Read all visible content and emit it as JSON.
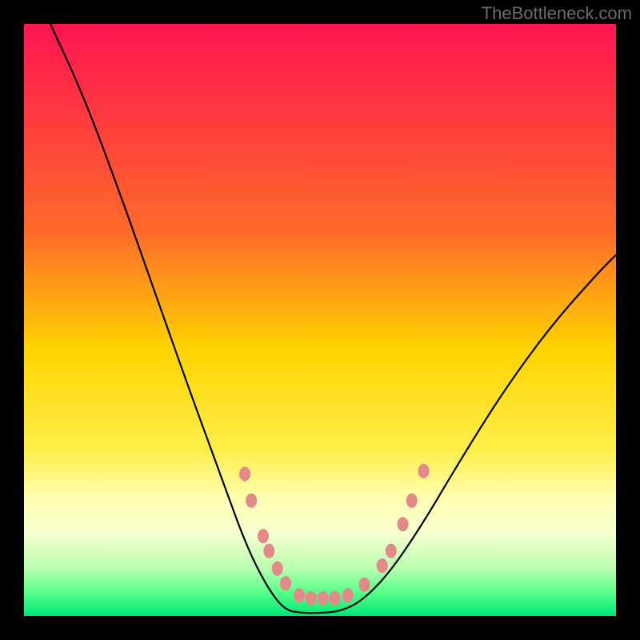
{
  "watermark": "TheBottleneck.com",
  "chart_data": {
    "type": "line",
    "title": "",
    "xlabel": "",
    "ylabel": "",
    "xlim": [
      0,
      100
    ],
    "ylim": [
      0,
      100
    ],
    "gradient_stops": [
      {
        "offset": 0,
        "color": "#ff1451"
      },
      {
        "offset": 35,
        "color": "#ff6a2a"
      },
      {
        "offset": 55,
        "color": "#ffd400"
      },
      {
        "offset": 72,
        "color": "#ffee4a"
      },
      {
        "offset": 80,
        "color": "#ffffb0"
      },
      {
        "offset": 86,
        "color": "#f7ffd0"
      },
      {
        "offset": 92,
        "color": "#b8ffb0"
      },
      {
        "offset": 96,
        "color": "#58ff8a"
      },
      {
        "offset": 100,
        "color": "#00e874"
      }
    ],
    "series": [
      {
        "name": "bottleneck-curve",
        "x": [
          4,
          10,
          16,
          22,
          28,
          33.5,
          37.5,
          41,
          44,
          47,
          50,
          53.5,
          57,
          61.5,
          67,
          73.5,
          81,
          89,
          97,
          100
        ],
        "values": [
          101,
          88,
          72,
          55,
          38,
          23,
          12,
          5,
          1,
          0.5,
          0.5,
          0.8,
          2.5,
          7,
          15,
          26,
          38,
          49,
          58,
          61
        ]
      }
    ],
    "markers": {
      "name": "highlight-dots",
      "color": "#e38a89",
      "rx": 7,
      "ry": 9,
      "points": [
        {
          "x": 37.3,
          "y": 24.0
        },
        {
          "x": 38.4,
          "y": 19.5
        },
        {
          "x": 40.4,
          "y": 13.5
        },
        {
          "x": 41.4,
          "y": 11.0
        },
        {
          "x": 42.8,
          "y": 8.0
        },
        {
          "x": 44.2,
          "y": 5.5
        },
        {
          "x": 46.5,
          "y": 3.5
        },
        {
          "x": 48.5,
          "y": 3.0
        },
        {
          "x": 50.5,
          "y": 3.0
        },
        {
          "x": 52.5,
          "y": 3.0
        },
        {
          "x": 54.7,
          "y": 3.5
        },
        {
          "x": 57.5,
          "y": 5.3
        },
        {
          "x": 60.5,
          "y": 8.5
        },
        {
          "x": 62.0,
          "y": 11.0
        },
        {
          "x": 64.0,
          "y": 15.5
        },
        {
          "x": 65.5,
          "y": 19.5
        },
        {
          "x": 67.5,
          "y": 24.5
        }
      ]
    }
  }
}
